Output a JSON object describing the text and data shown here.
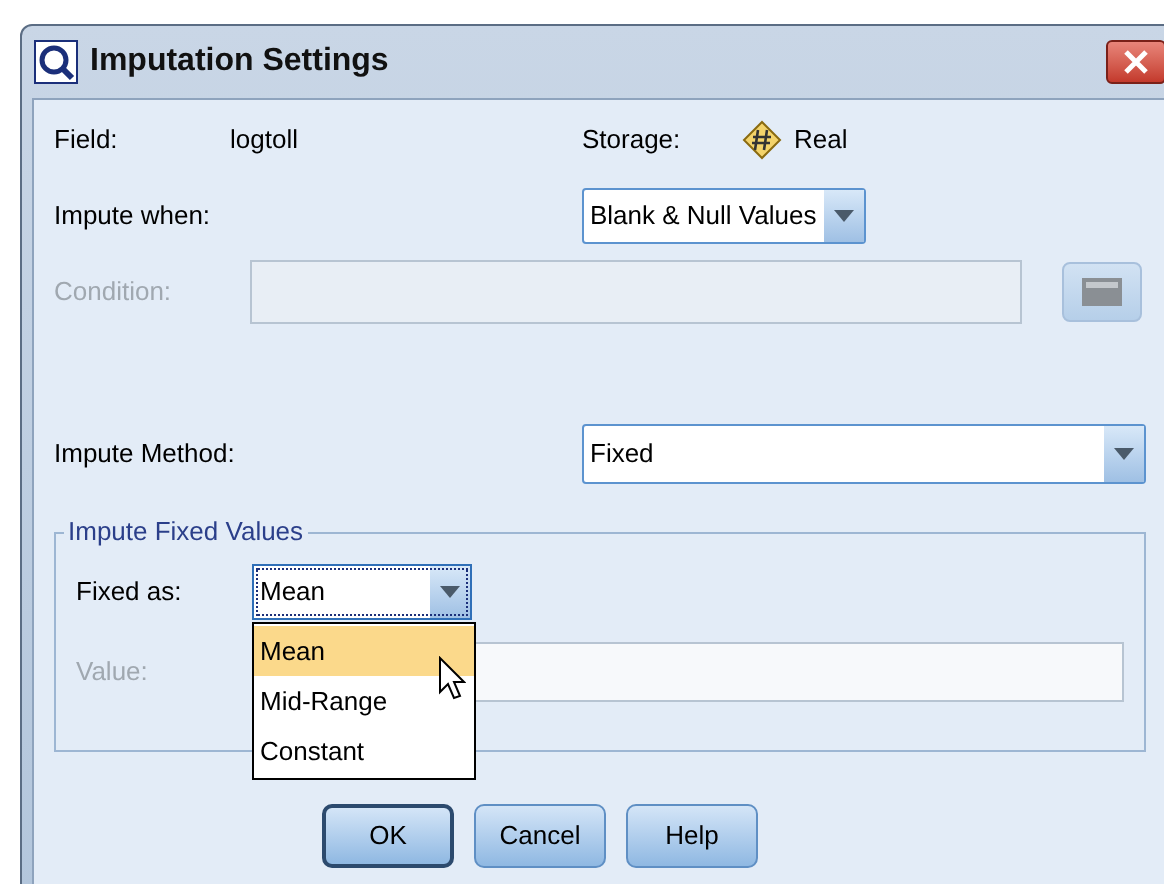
{
  "window": {
    "title": "Imputation Settings"
  },
  "field": {
    "label": "Field:",
    "value": "logtoll"
  },
  "storage": {
    "label": "Storage:",
    "value": "Real"
  },
  "impute_when": {
    "label": "Impute when:",
    "value": "Blank & Null Values"
  },
  "condition": {
    "label": "Condition:",
    "disabled": true
  },
  "impute_method": {
    "label": "Impute Method:",
    "value": "Fixed"
  },
  "group": {
    "title": "Impute Fixed Values",
    "fixed_as": {
      "label": "Fixed as:",
      "value": "Mean",
      "expanded": true,
      "options": [
        {
          "label": "Mean",
          "selected": true
        },
        {
          "label": "Mid-Range",
          "selected": false
        },
        {
          "label": "Constant",
          "selected": false
        }
      ]
    },
    "value": {
      "label": "Value:",
      "disabled": true
    }
  },
  "buttons": [
    {
      "label": "OK",
      "default": true
    },
    {
      "label": "Cancel",
      "default": false
    },
    {
      "label": "Help",
      "default": false
    }
  ]
}
